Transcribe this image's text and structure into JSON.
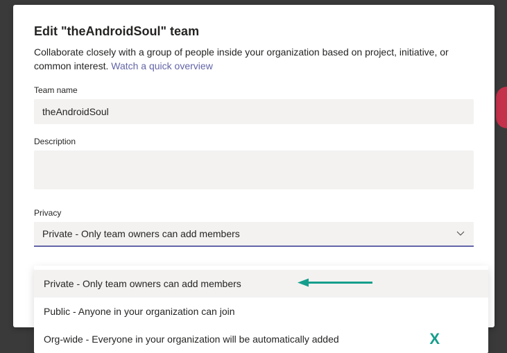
{
  "modal": {
    "title": "Edit \"theAndroidSoul\" team",
    "description_prefix": "Collaborate closely with a group of people inside your organization based on project, initiative, or common interest. ",
    "link_text": "Watch a quick overview"
  },
  "fields": {
    "team_name_label": "Team name",
    "team_name_value": "theAndroidSoul",
    "description_label": "Description",
    "description_value": "",
    "privacy_label": "Privacy",
    "privacy_selected": "Private - Only team owners can add members"
  },
  "dropdown": {
    "options": [
      "Private - Only team owners can add members",
      "Public - Anyone in your organization can join",
      "Org-wide - Everyone in your organization will be automatically added"
    ]
  },
  "annotations": {
    "x_mark": "X"
  },
  "colors": {
    "accent": "#6264a7",
    "annotation": "#159e8c"
  }
}
